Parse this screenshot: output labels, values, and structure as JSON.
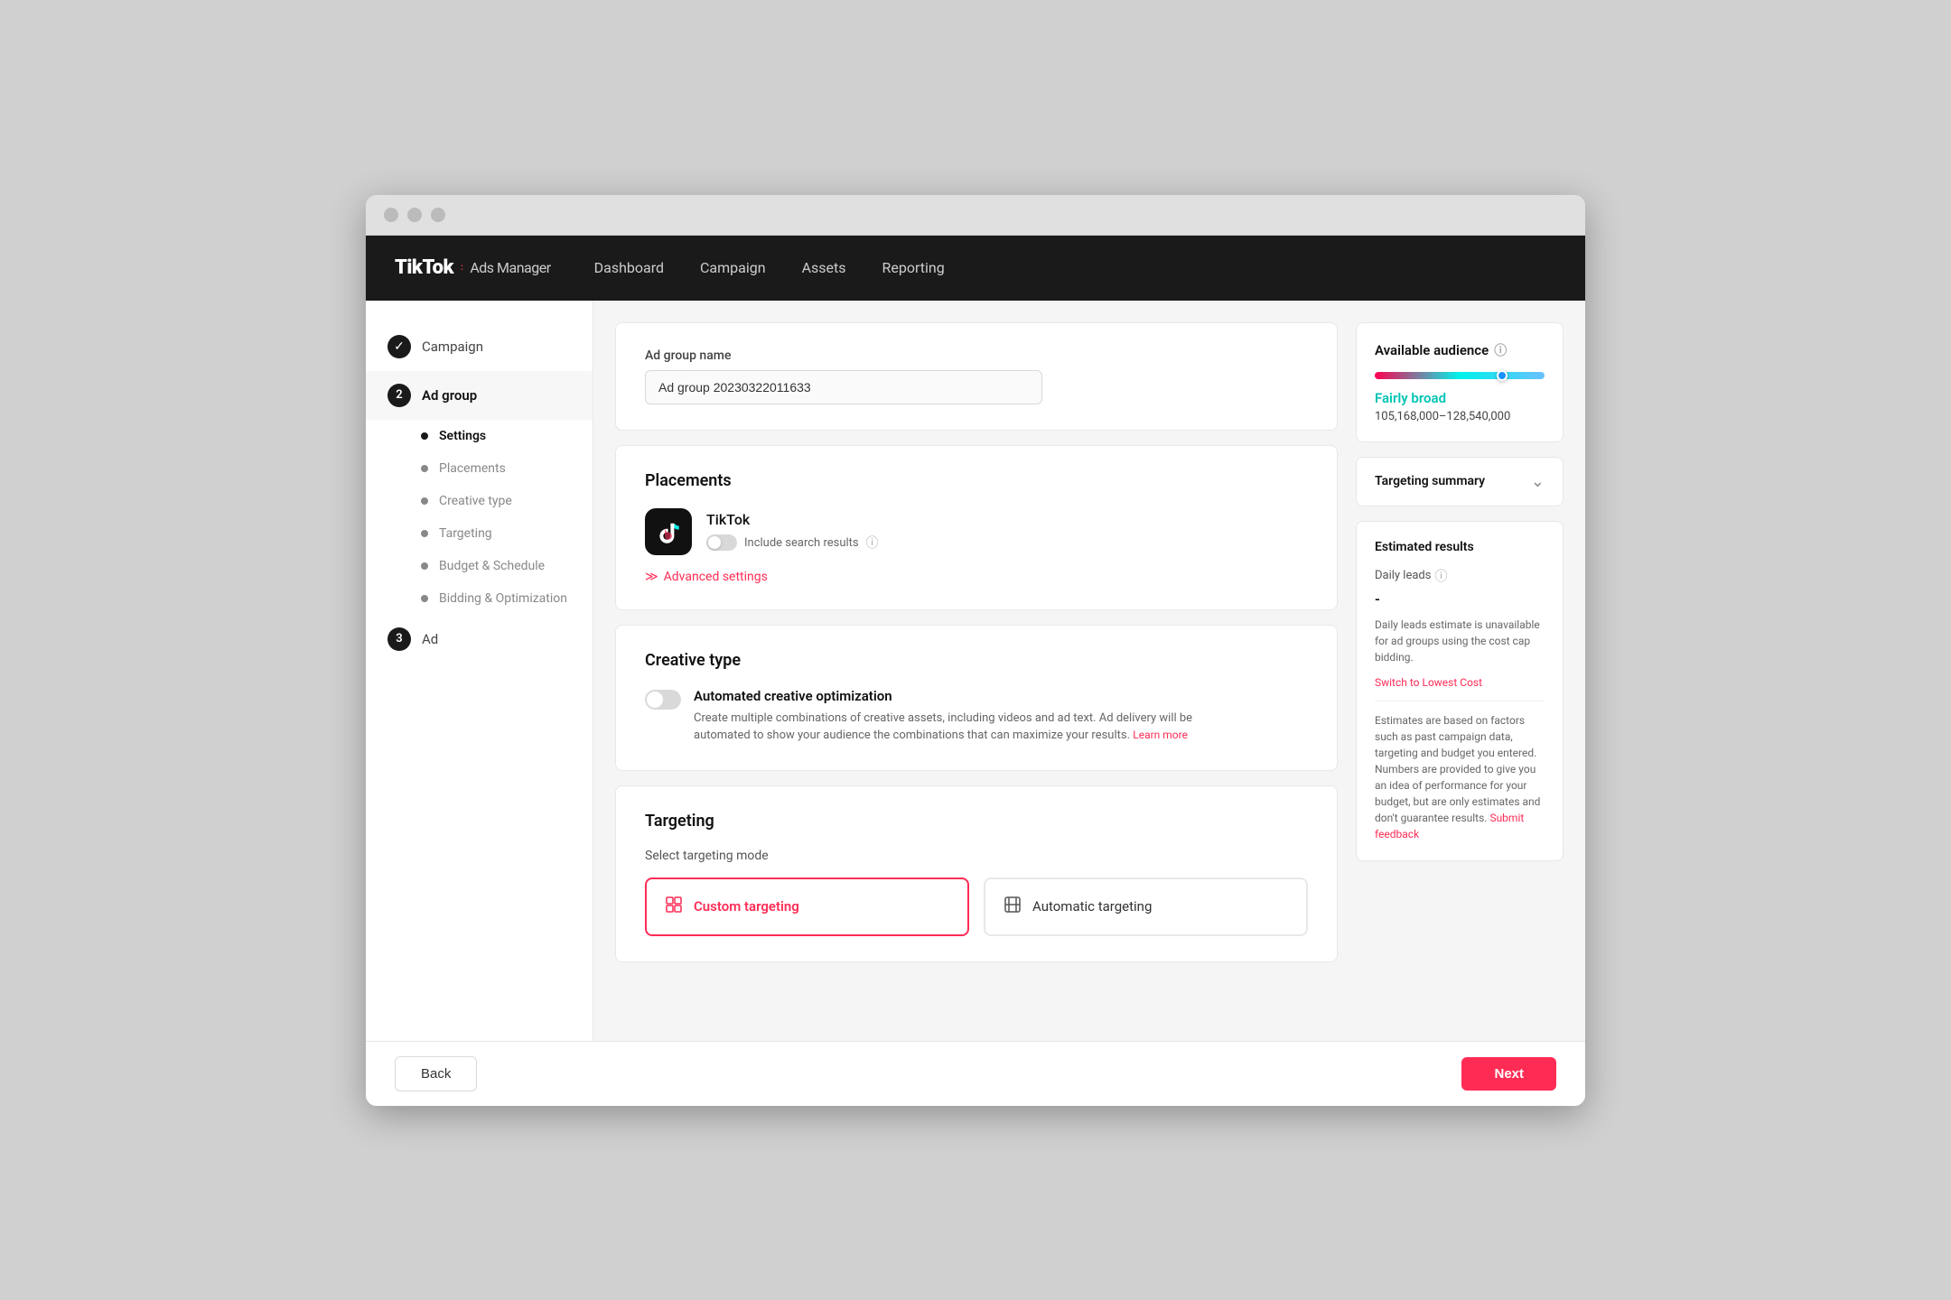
{
  "browser": {
    "traffic_lights": [
      "close",
      "minimize",
      "maximize"
    ]
  },
  "nav": {
    "logo_main": "TikTok",
    "logo_dot": ":",
    "logo_sub": "Ads Manager",
    "links": [
      "Dashboard",
      "Campaign",
      "Assets",
      "Reporting"
    ]
  },
  "sidebar": {
    "items": [
      {
        "id": "campaign",
        "label": "Campaign",
        "type": "check",
        "icon": "✓"
      },
      {
        "id": "ad-group",
        "label": "Ad group",
        "type": "number",
        "icon": "2"
      },
      {
        "id": "settings",
        "label": "Settings",
        "type": "bullet",
        "active": true
      },
      {
        "id": "placements",
        "label": "Placements",
        "type": "sub"
      },
      {
        "id": "creative-type",
        "label": "Creative type",
        "type": "sub"
      },
      {
        "id": "targeting",
        "label": "Targeting",
        "type": "sub"
      },
      {
        "id": "budget-schedule",
        "label": "Budget & Schedule",
        "type": "sub"
      },
      {
        "id": "bidding-optimization",
        "label": "Bidding & Optimization",
        "type": "sub"
      },
      {
        "id": "ad",
        "label": "Ad",
        "type": "number",
        "icon": "3"
      }
    ]
  },
  "ad_group_name": {
    "label": "Ad group name",
    "value": "Ad group 20230322011633"
  },
  "placements": {
    "title": "Placements",
    "tiktok_name": "TikTok",
    "include_search_label": "Include search results",
    "advanced_settings_label": "Advanced settings"
  },
  "creative_type": {
    "title": "Creative type",
    "toggle_label": "Automated creative optimization",
    "description": "Create multiple combinations of creative assets, including videos and ad text. Ad delivery will be automated to show your audience the combinations that can maximize your results.",
    "learn_more": "Learn more"
  },
  "targeting": {
    "title": "Targeting",
    "select_mode_label": "Select targeting mode",
    "options": [
      {
        "id": "custom",
        "label": "Custom targeting",
        "icon": "custom"
      },
      {
        "id": "automatic",
        "label": "Automatic targeting",
        "icon": "auto"
      }
    ],
    "selected": "custom"
  },
  "right_panel": {
    "available_audience": {
      "title": "Available audience",
      "breadth_label": "Fairly broad",
      "range": "105,168,000–128,540,000"
    },
    "targeting_summary": {
      "title": "Targeting summary"
    },
    "estimated_results": {
      "title": "Estimated results",
      "daily_leads_label": "Daily leads",
      "daily_leads_value": "-",
      "note": "Daily leads estimate is unavailable for ad groups using the cost cap bidding.",
      "switch_link": "Switch to Lowest Cost",
      "disclaimer": "Estimates are based on factors such as past campaign data, targeting and budget you entered. Numbers are provided to give you an idea of performance for your budget, but are only estimates and don't guarantee results.",
      "submit_link": "Submit feedback"
    }
  },
  "footer": {
    "back_label": "Back",
    "next_label": "Next"
  }
}
